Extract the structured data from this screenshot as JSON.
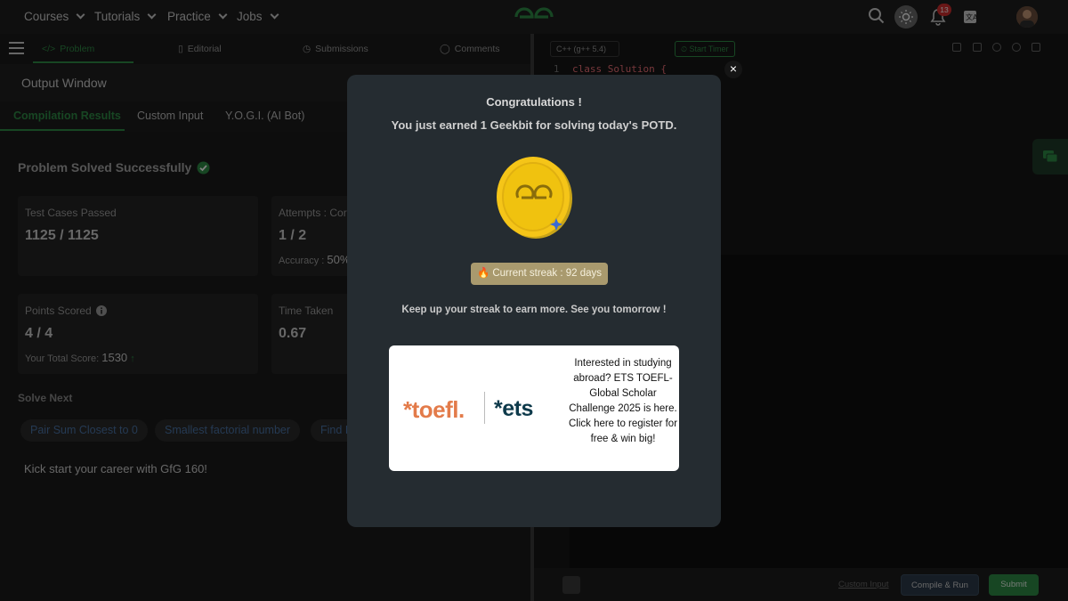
{
  "nav": {
    "items": [
      {
        "label": "Courses"
      },
      {
        "label": "Tutorials"
      },
      {
        "label": "Practice"
      },
      {
        "label": "Jobs"
      }
    ],
    "notification_count": "13"
  },
  "problem_tabs": {
    "problem": "Problem",
    "editorial": "Editorial",
    "submissions": "Submissions",
    "comments": "Comments"
  },
  "output": {
    "title": "Output Window",
    "subtabs": {
      "compilation": "Compilation Results",
      "custom_input": "Custom Input",
      "yogi": "Y.O.G.I. (AI Bot)"
    },
    "solved_text": "Problem Solved Successfully",
    "cards": {
      "test_cases_label": "Test Cases Passed",
      "test_cases_value": "1125 / 1125",
      "attempts_label": "Attempts : Corr",
      "attempts_value": "1 / 2",
      "accuracy_label": "Accuracy :",
      "accuracy_value": "50%",
      "points_label": "Points Scored",
      "points_value": "4 / 4",
      "total_score_label": "Your Total Score:",
      "total_score_value": "1530",
      "time_label": "Time Taken",
      "time_value": "0.67"
    },
    "solve_next_label": "Solve Next",
    "solve_next": [
      "Pair Sum Closest to 0",
      "Smallest factorial number",
      "Find I"
    ],
    "kickstart": "Kick start your career with GfG 160!"
  },
  "editor": {
    "language": "C++ (g++ 5.4)",
    "timer": "Start Timer",
    "line1": "class Solution {",
    "line_number": "1"
  },
  "bottom": {
    "custom_input": "Custom Input",
    "compile_run": "Compile & Run",
    "submit": "Submit"
  },
  "modal": {
    "title": "Congratulations !",
    "subtitle": "You just earned 1 Geekbit for solving today's POTD.",
    "streak": "Current streak : 92 days",
    "keep_up": "Keep up your streak to earn more. See you tomorrow !",
    "close": "×",
    "ad": {
      "brand1": "*toefl.",
      "brand2": "*ets",
      "text": "Interested in studying abroad? ETS TOEFL- Global Scholar Challenge 2025 is here. Click here to register for free & win big!"
    }
  },
  "colors": {
    "accent": "#2f8d46",
    "link": "#4a74a8",
    "coin": "#f5c518",
    "toefl": "#e37b4a",
    "ets": "#0e3a4b"
  }
}
